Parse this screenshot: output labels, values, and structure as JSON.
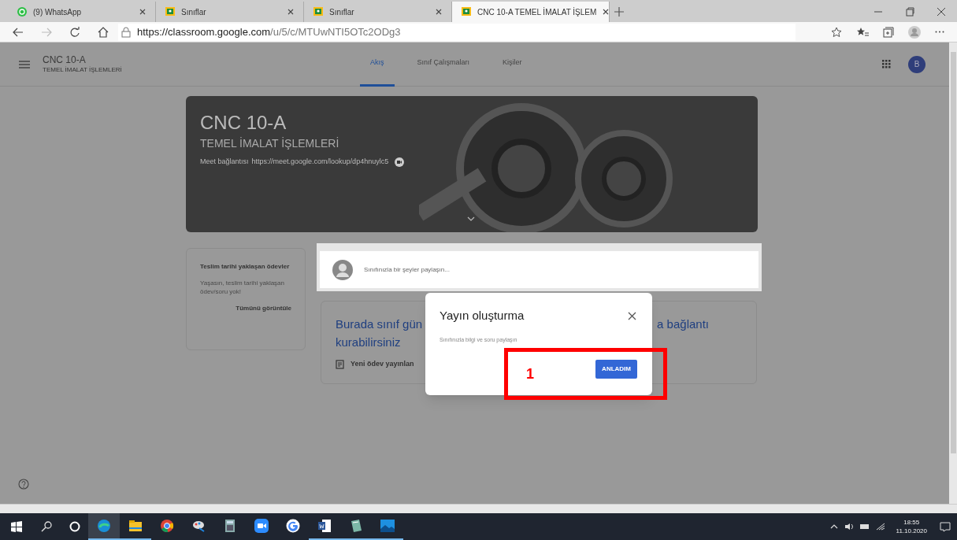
{
  "browser": {
    "tabs": [
      {
        "label": "(9) WhatsApp",
        "kind": "whatsapp",
        "selected": false
      },
      {
        "label": "Sınıflar",
        "kind": "classroom",
        "selected": false
      },
      {
        "label": "Sınıflar",
        "kind": "classroom",
        "selected": false
      },
      {
        "label": "CNC 10-A TEMEL İMALAT İŞLEM",
        "kind": "classroom",
        "selected": true
      }
    ],
    "url_host": "https://classroom.google.com",
    "url_path": "/u/5/c/MTUwNTI5OTc2ODg3"
  },
  "header": {
    "class_name": "CNC 10-A",
    "class_subject": "TEMEL İMALAT İŞLEMLERİ",
    "tabs": [
      {
        "label": "Akış",
        "selected": true
      },
      {
        "label": "Sınıf Çalışmaları",
        "selected": false
      },
      {
        "label": "Kişiler",
        "selected": false
      }
    ],
    "avatar_letter": "B"
  },
  "banner": {
    "title": "CNC 10-A",
    "subtitle": "TEMEL İMALAT İŞLEMLERİ",
    "meet_label": "Meet bağlantısı",
    "meet_link": "https://meet.google.com/lookup/dp4hnuylc5"
  },
  "upcoming": {
    "title": "Teslim tarihi yaklaşan ödevler",
    "message": "Yaşasın, teslim tarihi yaklaşan ödev/soru yok!",
    "view_all": "Tümünü görüntüle"
  },
  "share_box": {
    "placeholder": "Sınıfınızla bir şeyler paylaşın..."
  },
  "welcome_card": {
    "text_left": "Burada sınıf gün",
    "text_right": "a bağlantı",
    "text_line2": "kurabilirsiniz",
    "action": "Yeni ödev yayınlan"
  },
  "dialog": {
    "title": "Yayın oluşturma",
    "body": "Sınıfınızla bilgi ve soru paylaşın",
    "button": "ANLADIM"
  },
  "annotation": {
    "label": "1"
  },
  "taskbar": {
    "apps": [
      {
        "kind": "edge",
        "running": true,
        "selected": true
      },
      {
        "kind": "folder",
        "running": true,
        "selected": false
      },
      {
        "kind": "chrome",
        "running": false,
        "selected": false
      },
      {
        "kind": "paint",
        "running": false,
        "selected": false
      },
      {
        "kind": "calculator",
        "running": false,
        "selected": false
      },
      {
        "kind": "video",
        "running": false,
        "selected": false
      },
      {
        "kind": "google",
        "running": false,
        "selected": false
      },
      {
        "kind": "word",
        "running": true,
        "selected": false
      },
      {
        "kind": "notebook",
        "running": true,
        "selected": false
      },
      {
        "kind": "photos",
        "running": true,
        "selected": false
      }
    ],
    "time": "18:55",
    "date": "11.10.2020"
  }
}
